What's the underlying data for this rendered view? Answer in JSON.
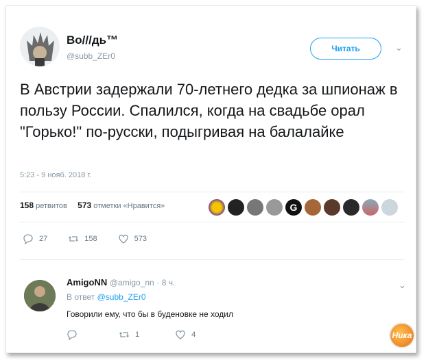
{
  "tweet": {
    "display_name": "Во///дь™",
    "handle": "@subb_ZEr0",
    "follow_label": "Читать",
    "text": "В Австрии задержали 70-летнего дедка  за шпионаж в пользу России. Спалился, когда на свадьбе орал \"Горько!\" по-русски, подыгривая на балалайке",
    "timestamp": "5:23 - 9 нояб. 2018 г.",
    "retweets_count": "158",
    "retweets_label": "ретвитов",
    "likes_count": "573",
    "likes_label": "отметки «Нравится»",
    "actions": {
      "replies": "27",
      "retweets": "158",
      "likes": "573"
    }
  },
  "reply": {
    "display_name": "AmigoNN",
    "handle": "@amigo_nn",
    "age": "· 8 ч.",
    "in_reply_label": "В ответ",
    "in_reply_handle": "@subb_ZEr0",
    "text": "Говорили ему,  что бы в буденовке не ходил",
    "actions": {
      "replies": "",
      "retweets": "1",
      "likes": "4"
    }
  },
  "watermark": "Ника",
  "colors": {
    "accent": "#1da1f2",
    "muted": "#8899a6",
    "text": "#14171a"
  },
  "liker_avatars": [
    "avatar-1",
    "avatar-2",
    "avatar-3",
    "avatar-4",
    "avatar-5",
    "avatar-6",
    "avatar-7",
    "avatar-8",
    "avatar-9",
    "avatar-10"
  ]
}
